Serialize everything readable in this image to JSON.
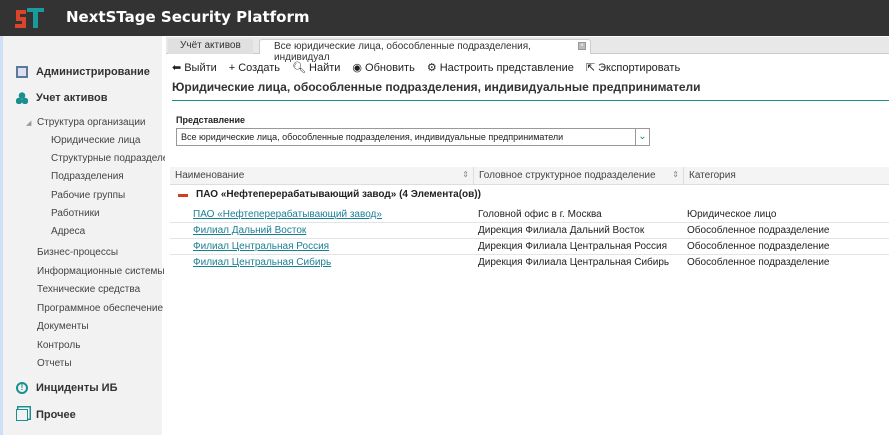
{
  "app": {
    "title": "NextSTage Security Platform"
  },
  "sidebar": {
    "admin": "Администрирование",
    "assets": "Учет активов",
    "org": "Структура организации",
    "sub": [
      "Юридические лица",
      "Структурные подразделения",
      "Подразделения",
      "Рабочие группы",
      "Работники",
      "Адреса"
    ],
    "items": [
      "Бизнес-процессы",
      "Информационные системы",
      "Технические средства",
      "Программное обеспечение",
      "Документы",
      "Контроль",
      "Отчеты"
    ],
    "incidents": "Инциденты ИБ",
    "other": "Прочее"
  },
  "tabs": [
    "Учёт активов",
    "Все юридические лица, обособленные подразделения, индивидуал"
  ],
  "toolbar": [
    "Выйти",
    "Создать",
    "Найти",
    "Обновить",
    "Настроить представление",
    "Экспортировать"
  ],
  "page_title": "Юридические лица, обособленные подразделения, индивидуальные предприниматели",
  "view": {
    "label": "Представление",
    "value": "Все юридические лица, обособленные подразделения, индивидуальные предприниматели"
  },
  "table": {
    "headers": [
      "Наименование",
      "Головное структурное подразделение",
      "Категория"
    ],
    "group": "ПАО «Нефтеперерабатывающий завод» (4 Элемента(ов))",
    "rows": [
      [
        "ПАО «Нефтеперерабатывающий завод»",
        "Головной офис в г. Москва",
        "Юридическое лицо"
      ],
      [
        "Филиал Дальний Восток",
        "Дирекция Филиала Дальний Восток",
        "Обособленное подразделение"
      ],
      [
        "Филиал Центральная Россия",
        "Дирекция Филиала Центральная Россия",
        "Обособленное подразделение"
      ],
      [
        "Филиал Центральная Сибирь",
        "Дирекция Филиала Центральная Сибирь",
        "Обособленное подразделение"
      ]
    ]
  }
}
